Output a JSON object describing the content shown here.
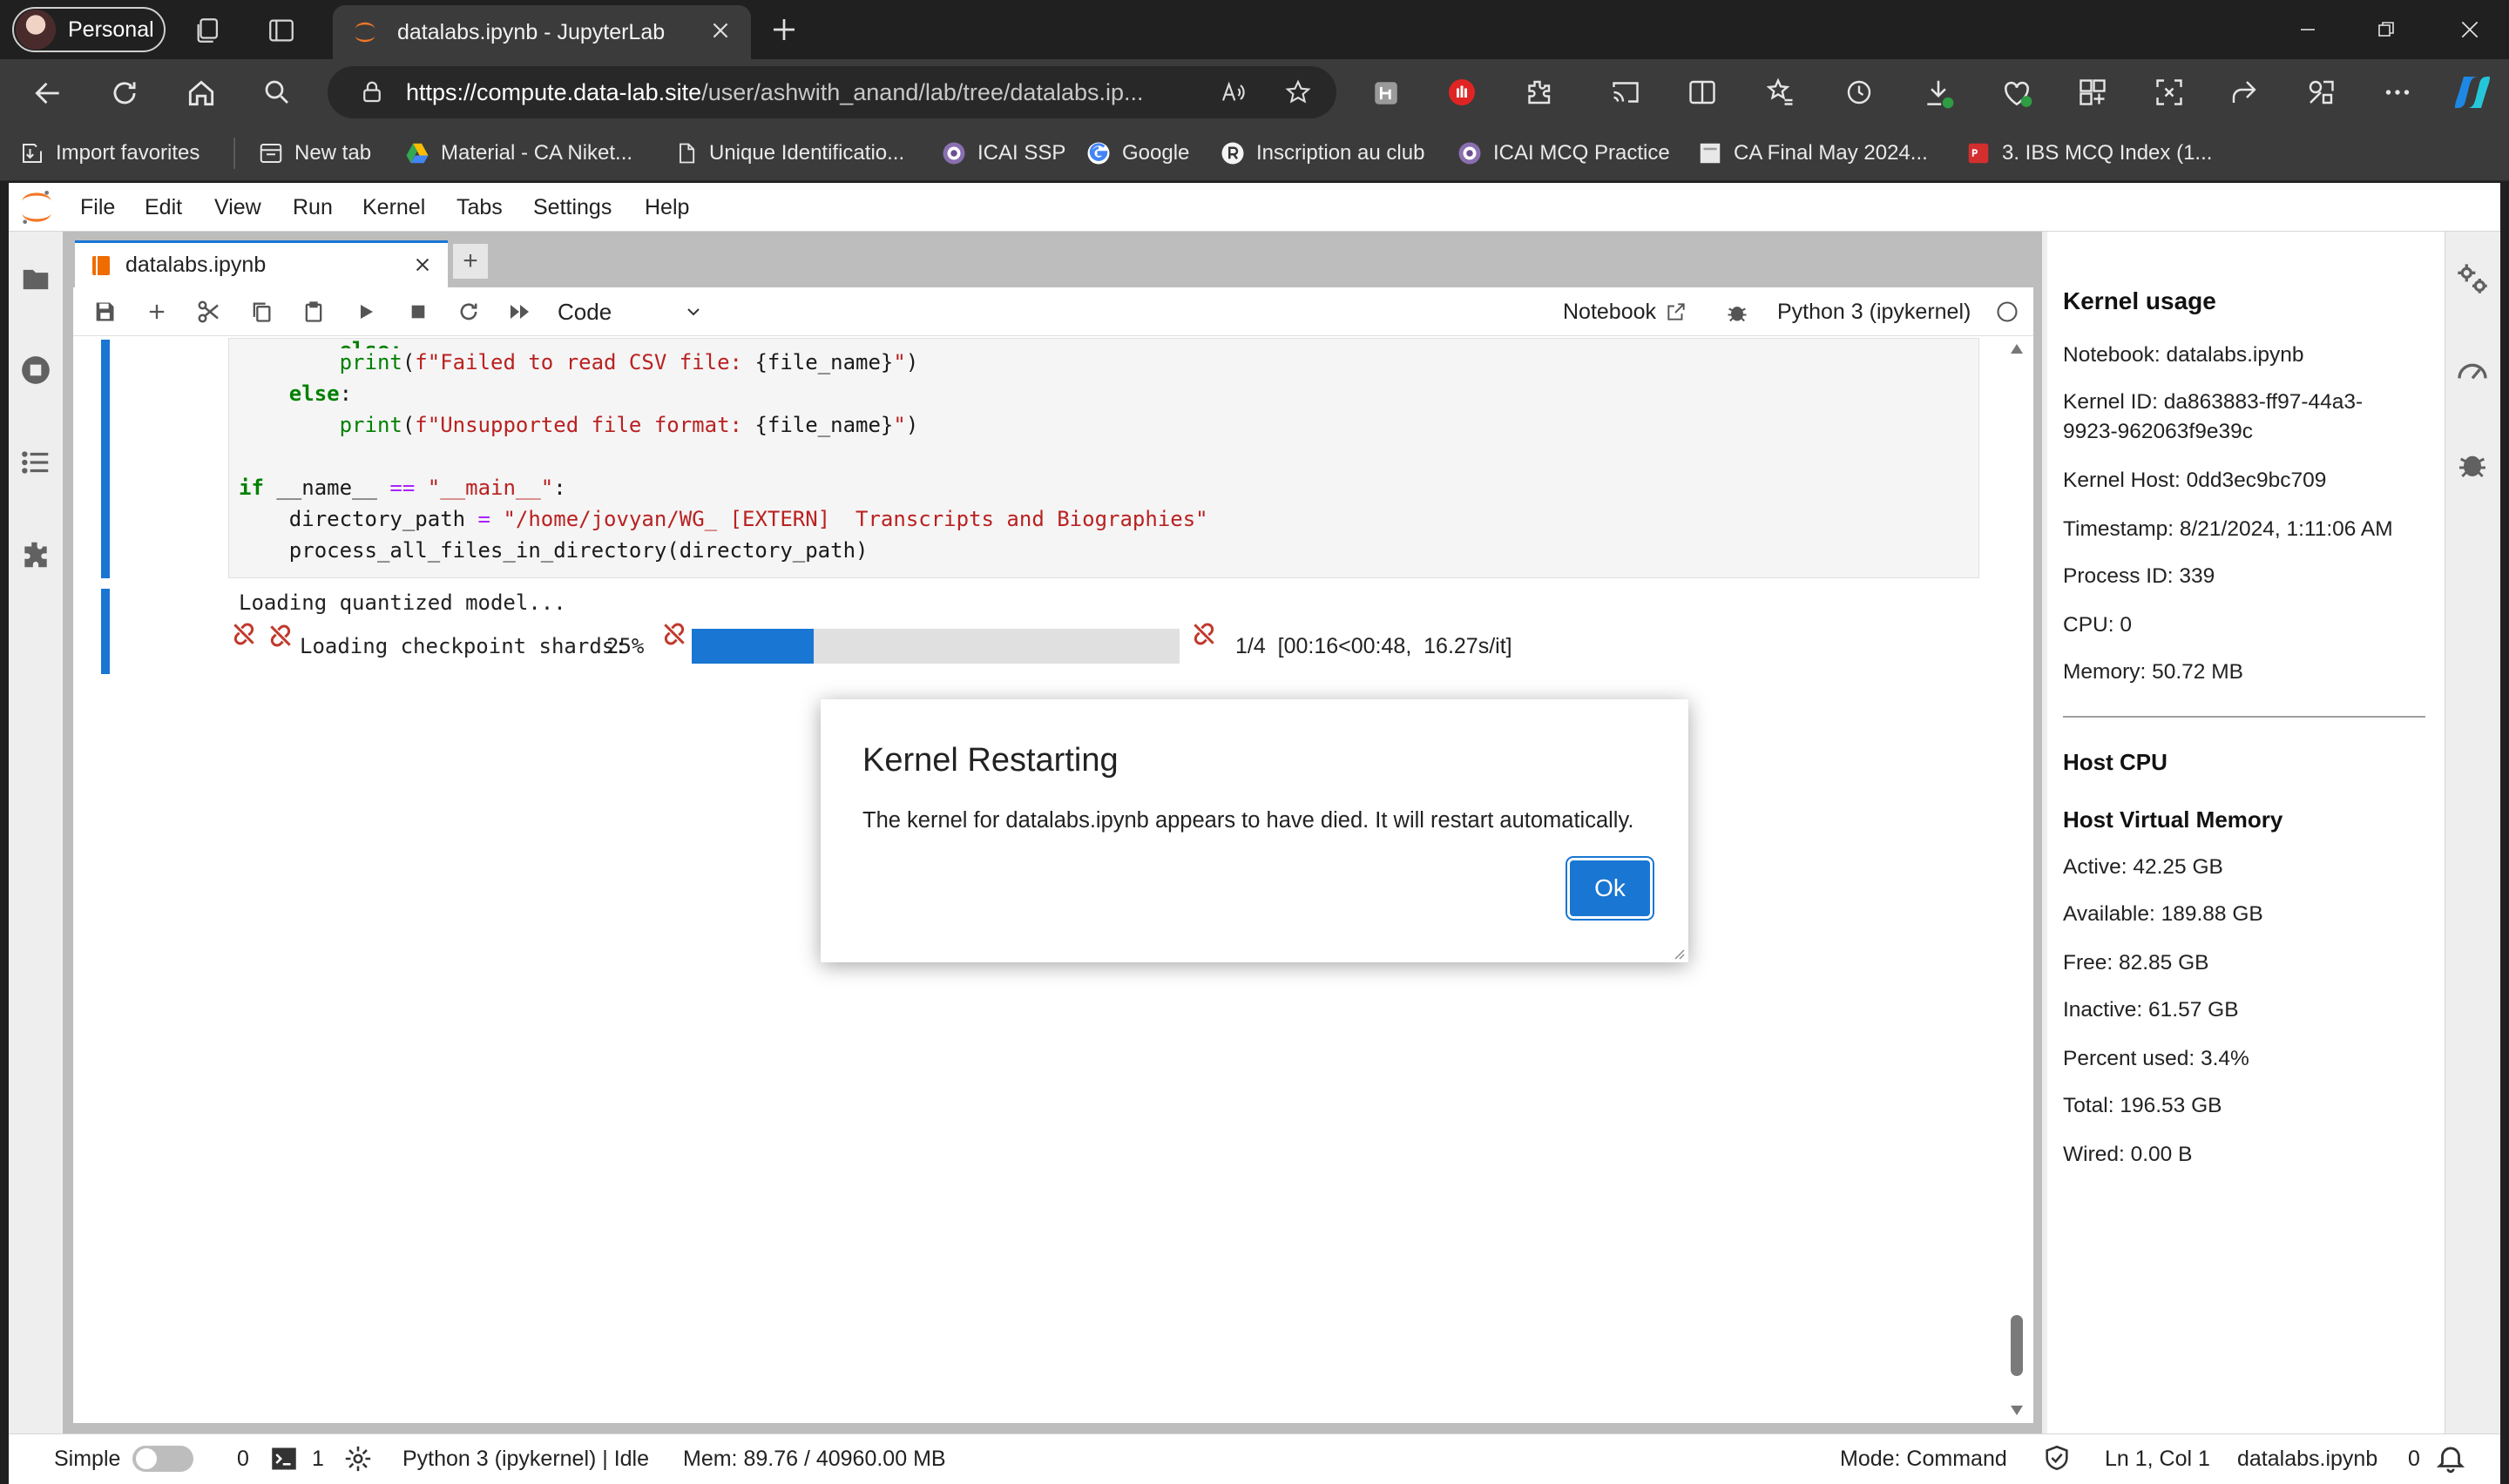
{
  "browser": {
    "profile_label": "Personal",
    "tab_title": "datalabs.ipynb - JupyterLab",
    "url_host": "https://compute.data-lab.site",
    "url_path": "/user/ashwith_anand/lab/tree/datalabs.ip...",
    "bookmarks": [
      {
        "label": "Import favorites",
        "icon": "import-icon"
      },
      {
        "label": "New tab",
        "icon": "new-tab-icon"
      },
      {
        "label": "Material - CA Niket...",
        "icon": "google-drive-icon"
      },
      {
        "label": "Unique Identificatio...",
        "icon": "document-icon"
      },
      {
        "label": "ICAI SSP",
        "icon": "icai-logo-icon"
      },
      {
        "label": "Google",
        "icon": "google-icon"
      },
      {
        "label": "Inscription au club",
        "icon": "r-logo-icon"
      },
      {
        "label": "ICAI MCQ Practice",
        "icon": "icai-logo-icon"
      },
      {
        "label": "CA Final May 2024...",
        "icon": "page-icon"
      },
      {
        "label": "3. IBS MCQ Index (1...",
        "icon": "pdf-icon"
      }
    ]
  },
  "jupyter": {
    "menus": [
      "File",
      "Edit",
      "View",
      "Run",
      "Kernel",
      "Tabs",
      "Settings",
      "Help"
    ],
    "doc_tab": "datalabs.ipynb",
    "cell_type": "Code",
    "notebook_link": "Notebook",
    "kernel_name": "Python 3 (ipykernel)",
    "code_lines": [
      "            print(f\"Failed to read CSV file: {file_name}\")",
      "        else:",
      "            print(f\"Unsupported file format: {file_name}\")",
      "",
      "if __name__ == \"__main__\":",
      "    directory_path = \"/home/jovyan/WG_ [EXTERN]  Transcripts and Biographies\"",
      "    process_all_files_in_directory(directory_path)"
    ],
    "output_line1": "Loading quantized model...",
    "output_label": "Loading checkpoint shards:",
    "progress_percent_label": "25%",
    "progress_fraction": 0.25,
    "progress_counts": "1/4  [00:16<00:48,  16.27s/it]"
  },
  "kernel_usage": {
    "title": "Kernel usage",
    "notebook": "Notebook: datalabs.ipynb",
    "kernel_id_1": "Kernel ID: da863883-ff97-44a3-",
    "kernel_id_2": "9923-962063f9e39c",
    "kernel_host": "Kernel Host: 0dd3ec9bc709",
    "timestamp": "Timestamp: 8/21/2024, 1:11:06 AM",
    "process_id": "Process ID: 339",
    "cpu": "CPU: 0",
    "memory": "Memory: 50.72 MB",
    "host_cpu_title": "Host CPU",
    "host_vm_title": "Host Virtual Memory",
    "active": "Active: 42.25 GB",
    "available": "Available: 189.88 GB",
    "free": "Free: 82.85 GB",
    "inactive": "Inactive: 61.57 GB",
    "percent_used": "Percent used: 3.4%",
    "total": "Total: 196.53 GB",
    "wired": "Wired: 0.00 B"
  },
  "dialog": {
    "title": "Kernel Restarting",
    "body": "The kernel for datalabs.ipynb appears to have died. It will restart automatically.",
    "ok_label": "Ok"
  },
  "statusbar": {
    "simple_label": "Simple",
    "count_a": "0",
    "count_b": "1",
    "kernel_status": "Python 3 (ipykernel) | Idle",
    "mem": "Mem: 89.76 / 40960.00 MB",
    "mode": "Mode: Command",
    "position": "Ln 1, Col 1",
    "file": "datalabs.ipynb",
    "notifications": "0"
  },
  "colors": {
    "accent": "#1976d2",
    "jupyter_orange": "#f37726",
    "error_red": "#c0392b"
  }
}
